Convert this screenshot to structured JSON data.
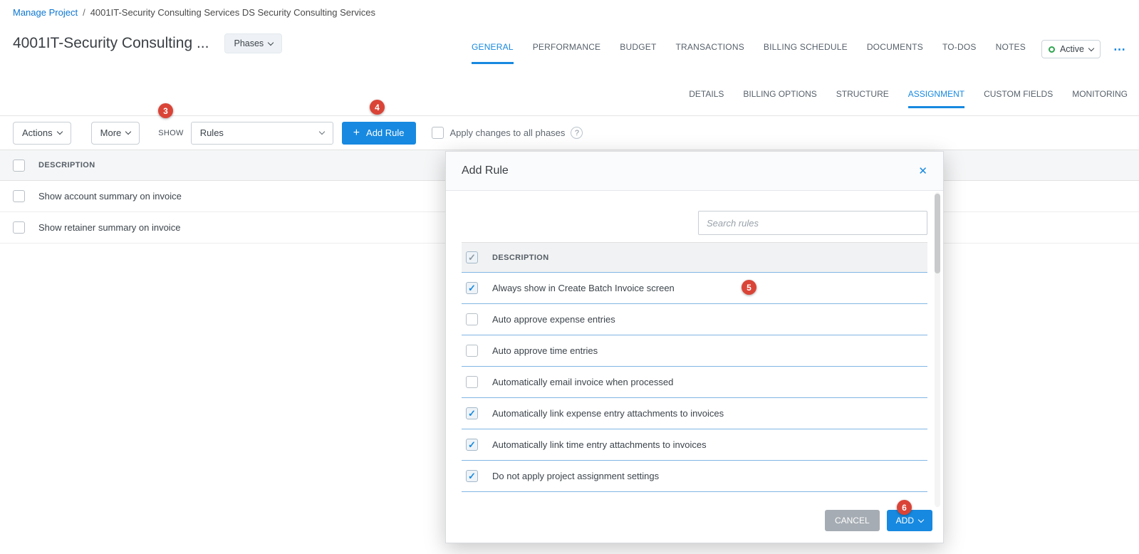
{
  "breadcrumb": {
    "link": "Manage Project",
    "separator": "/",
    "current": "4001IT-Security Consulting Services DS Security Consulting Services"
  },
  "header": {
    "title": "4001IT-Security Consulting ...",
    "phases_button": "Phases",
    "more_menu_icon": "⋯"
  },
  "status": {
    "label": "Active"
  },
  "tabs": [
    "GENERAL",
    "PERFORMANCE",
    "BUDGET",
    "TRANSACTIONS",
    "BILLING SCHEDULE",
    "DOCUMENTS",
    "TO-DOS",
    "NOTES"
  ],
  "active_tab": "GENERAL",
  "subtabs": [
    "DETAILS",
    "BILLING OPTIONS",
    "STRUCTURE",
    "ASSIGNMENT",
    "CUSTOM FIELDS",
    "MONITORING"
  ],
  "active_subtab": "ASSIGNMENT",
  "toolbar": {
    "actions_label": "Actions",
    "more_label": "More",
    "show_label": "SHOW",
    "filter_value": "Rules",
    "plus_icon": "+",
    "add_rule_label": "Add Rule",
    "apply_checkbox_label": "Apply changes to all phases",
    "apply_checked": false,
    "help_icon": "?"
  },
  "main_table": {
    "description_header": "DESCRIPTION",
    "header_checked": false,
    "rows": [
      {
        "label": "Show account summary on invoice",
        "checked": false
      },
      {
        "label": "Show retainer summary on invoice",
        "checked": false
      }
    ]
  },
  "modal": {
    "title": "Add Rule",
    "close_icon": "✕",
    "search_placeholder": "Search rules",
    "description_header": "DESCRIPTION",
    "header_checked": true,
    "rows": [
      {
        "label": "Always show in Create Batch Invoice screen",
        "checked": true
      },
      {
        "label": "Auto approve expense entries",
        "checked": false
      },
      {
        "label": "Auto approve time entries",
        "checked": false
      },
      {
        "label": "Automatically email invoice when processed",
        "checked": false
      },
      {
        "label": "Automatically link expense entry attachments to invoices",
        "checked": true
      },
      {
        "label": "Automatically link time entry attachments to invoices",
        "checked": true
      },
      {
        "label": "Do not apply project assignment settings",
        "checked": true
      }
    ],
    "cancel_label": "CANCEL",
    "add_label": "ADD"
  },
  "annotations": {
    "badge_3": "3",
    "badge_4": "4",
    "badge_5": "5",
    "badge_6": "6"
  },
  "colors": {
    "accent_blue": "#1789e0",
    "badge_red": "#da4437",
    "active_green": "#2ea44f",
    "row_divider_blue": "#80b6e4"
  }
}
